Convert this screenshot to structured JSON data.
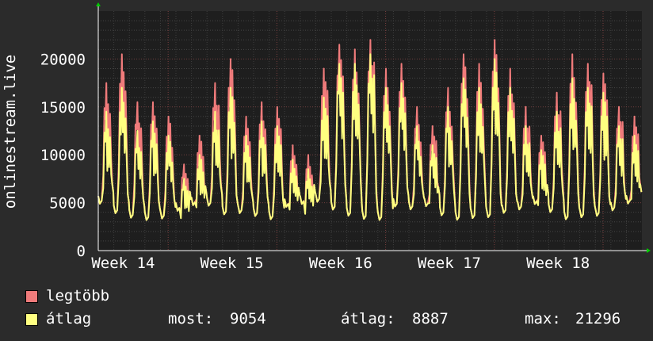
{
  "chart_data": {
    "type": "line",
    "title": "",
    "ylabel": "onlinestream.live",
    "xlabel": "",
    "x_ticks": [
      "Week 14",
      "Week 15",
      "Week 16",
      "Week 17",
      "Week 18"
    ],
    "y_ticks": [
      0,
      5000,
      10000,
      15000,
      20000
    ],
    "ylim": [
      0,
      25000
    ],
    "grid": true,
    "days": 35,
    "series": [
      {
        "name": "legtöbb",
        "color": "#f07b7b",
        "daily_peaks": [
          17500,
          20500,
          15500,
          15500,
          14000,
          9000,
          12000,
          17500,
          20000,
          14000,
          15500,
          15000,
          11000,
          10000,
          19000,
          21500,
          21000,
          22000,
          19000,
          19500,
          15000,
          13000,
          17000,
          20500,
          19500,
          22000,
          19000,
          15000,
          12000,
          16500,
          20500,
          19500,
          18500,
          15000,
          14000
        ]
      },
      {
        "name": "átlag",
        "color": "#ffff80",
        "daily_peaks": [
          14500,
          17000,
          12500,
          13500,
          12000,
          7500,
          10000,
          14500,
          17000,
          12000,
          13500,
          13000,
          9500,
          8500,
          16000,
          19500,
          19500,
          20500,
          17000,
          17500,
          13000,
          11000,
          15000,
          18000,
          17000,
          20000,
          17000,
          13000,
          10500,
          14500,
          18000,
          17000,
          16500,
          13000,
          12000
        ]
      }
    ]
  },
  "legend": {
    "max_label": "legtöbb",
    "avg_label": "átlag",
    "max_color": "#f07b7b",
    "avg_color": "#ffff80"
  },
  "stats": {
    "current_label": "most:",
    "current_value": "9054",
    "avg_label": "átlag:",
    "avg_value": "8887",
    "max_label": "max:",
    "max_value": "21296"
  }
}
